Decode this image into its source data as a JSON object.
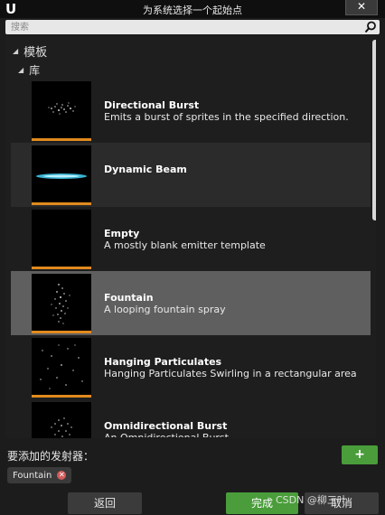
{
  "window": {
    "logo_text": "U",
    "title": "为系统选择一个起始点",
    "close_label": "✕"
  },
  "search": {
    "placeholder": "搜索"
  },
  "tree": {
    "category": "模板",
    "subcategory": "库"
  },
  "items": [
    {
      "name": "Directional Burst",
      "desc": "Emits a burst of sprites in the specified direction.",
      "state": "normal"
    },
    {
      "name": "Dynamic Beam",
      "desc": "",
      "state": "hovered"
    },
    {
      "name": "Empty",
      "desc": "A mostly blank emitter template",
      "state": "normal"
    },
    {
      "name": "Fountain",
      "desc": "A looping fountain spray",
      "state": "selected"
    },
    {
      "name": "Hanging Particulates",
      "desc": "Hanging Particulates Swirling in a rectangular area",
      "state": "normal"
    },
    {
      "name": "Omnidirectional Burst",
      "desc": "An Omnidirectional Burst",
      "state": "normal"
    }
  ],
  "emitters": {
    "label": "要添加的发射器：",
    "add_label": "+",
    "selected": [
      {
        "name": "Fountain"
      }
    ]
  },
  "footer": {
    "back_label": "返回",
    "done_label": "完成",
    "cancel_label": "取消"
  },
  "watermark": "CSDN @柳三叶",
  "colors": {
    "accent_orange": "#e08a1e",
    "green_button": "#4a9d3a",
    "selection": "#5f5f5f",
    "beam_cyan": "#3fc6e8"
  }
}
